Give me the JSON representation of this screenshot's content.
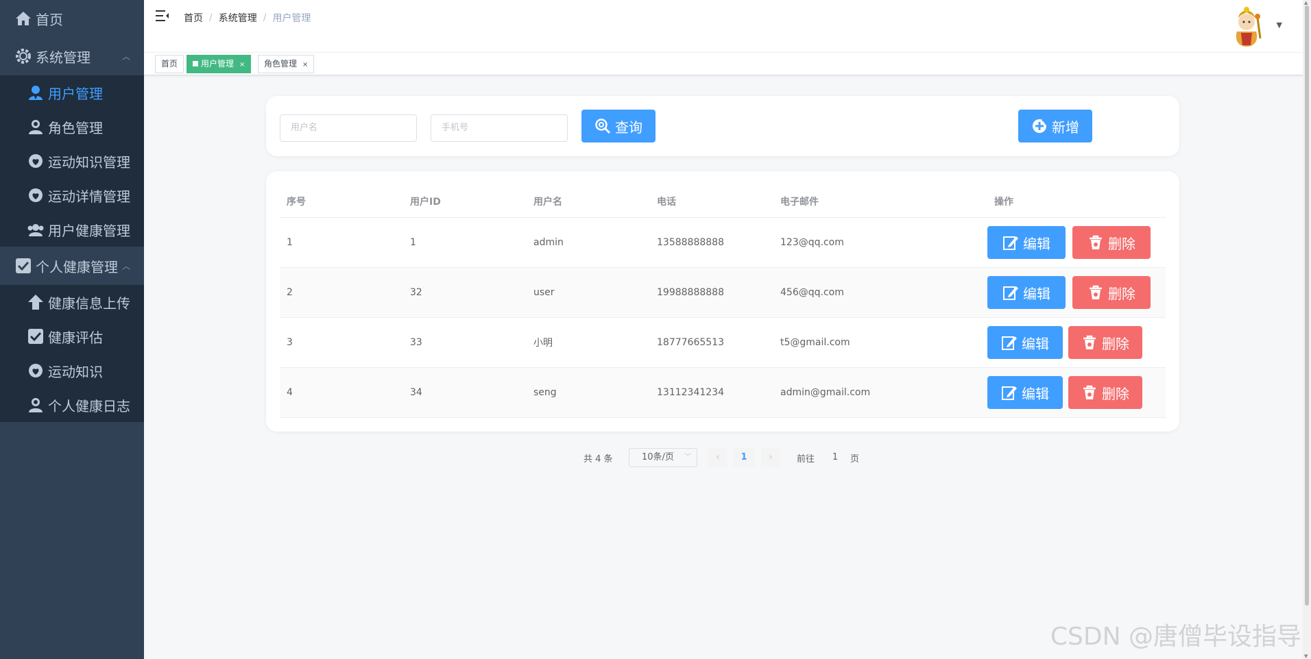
{
  "sidebar": {
    "home": "首页",
    "groups": [
      {
        "label": "系统管理",
        "items": [
          {
            "label": "用户管理",
            "icon": "user-icon",
            "active": true
          },
          {
            "label": "角色管理",
            "icon": "user-icon"
          },
          {
            "label": "运动知识管理",
            "icon": "heart-circle-icon"
          },
          {
            "label": "运动详情管理",
            "icon": "heart-circle-icon"
          },
          {
            "label": "用户健康管理",
            "icon": "group-icon"
          }
        ]
      },
      {
        "label": "个人健康管理",
        "items": [
          {
            "label": "健康信息上传",
            "icon": "upload-icon"
          },
          {
            "label": "健康评估",
            "icon": "check-box-icon"
          },
          {
            "label": "运动知识",
            "icon": "heart-circle-icon"
          },
          {
            "label": "个人健康日志",
            "icon": "user-icon"
          }
        ]
      }
    ]
  },
  "header": {
    "breadcrumb": [
      "首页",
      "系统管理",
      "用户管理"
    ]
  },
  "tags": [
    {
      "label": "首页"
    },
    {
      "label": "用户管理",
      "active": true,
      "close": "×"
    },
    {
      "label": "角色管理",
      "close": "×"
    }
  ],
  "search": {
    "username_placeholder": "用户名",
    "phone_placeholder": "手机号",
    "query_label": "查询",
    "add_label": "新增"
  },
  "table": {
    "columns": [
      "序号",
      "用户ID",
      "用户名",
      "电话",
      "电子邮件",
      "操作"
    ],
    "rows": [
      {
        "index": "1",
        "id": "1",
        "name": "admin",
        "phone": "13588888888",
        "email": "123@qq.com"
      },
      {
        "index": "2",
        "id": "32",
        "name": "user",
        "phone": "19988888888",
        "email": "456@qq.com"
      },
      {
        "index": "3",
        "id": "33",
        "name": "小明",
        "phone": "18777665513",
        "email": "t5@gmail.com"
      },
      {
        "index": "4",
        "id": "34",
        "name": "seng",
        "phone": "13112341234",
        "email": "admin@gmail.com"
      }
    ],
    "edit_label": "编辑",
    "delete_label": "删除"
  },
  "pagination": {
    "total": "共 4 条",
    "page_size": "10条/页",
    "current_page": "1",
    "goto_prefix": "前往",
    "goto_value": "1",
    "goto_suffix": "页"
  },
  "watermark": "CSDN @唐僧毕设指导",
  "colors": {
    "sidebar_bg": "#304156",
    "submenu_bg": "#1f2d3d",
    "primary": "#409eff",
    "danger": "#f56c6c",
    "tag_active": "#42b983"
  }
}
